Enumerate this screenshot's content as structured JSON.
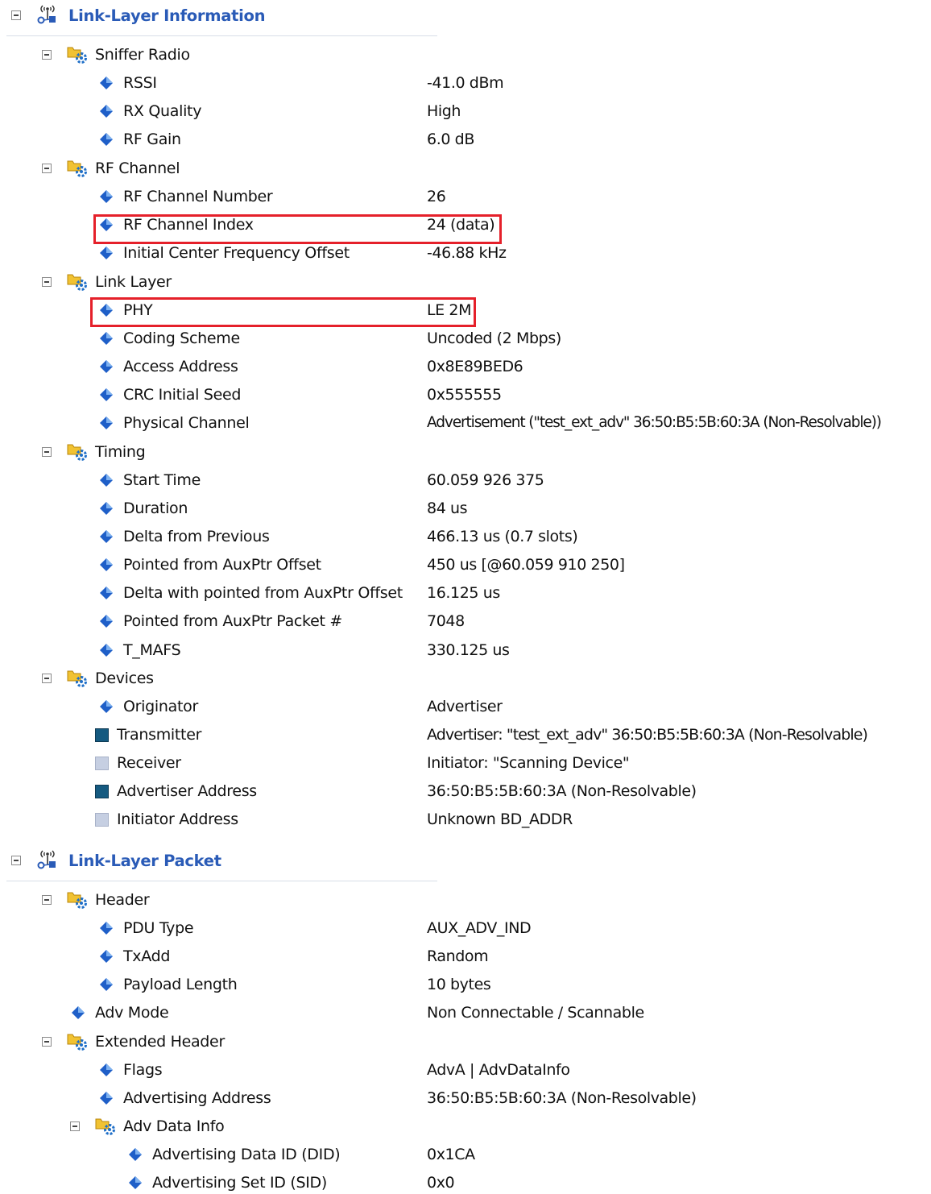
{
  "sections": [
    {
      "label": "Link-Layer Information"
    },
    {
      "label": "Link-Layer Packet"
    }
  ],
  "groups": {
    "sniffer_radio": "Sniffer Radio",
    "rf_channel": "RF Channel",
    "link_layer": "Link Layer",
    "timing": "Timing",
    "devices": "Devices",
    "header": "Header",
    "extended_header": "Extended Header",
    "adv_data_info": "Adv Data Info"
  },
  "fields": {
    "rssi": {
      "label": "RSSI",
      "value": "-41.0 dBm"
    },
    "rx_quality": {
      "label": "RX Quality",
      "value": "High"
    },
    "rf_gain": {
      "label": "RF Gain",
      "value": "6.0 dB"
    },
    "rf_channel_number": {
      "label": "RF Channel Number",
      "value": "26"
    },
    "rf_channel_index": {
      "label": "RF Channel Index",
      "value": "24 (data)"
    },
    "initial_center_freq_offset": {
      "label": "Initial Center Frequency Offset",
      "value": "-46.88 kHz"
    },
    "phy": {
      "label": "PHY",
      "value": "LE 2M"
    },
    "coding_scheme": {
      "label": "Coding Scheme",
      "value": "Uncoded (2 Mbps)"
    },
    "access_address": {
      "label": "Access Address",
      "value": "0x8E89BED6"
    },
    "crc_initial_seed": {
      "label": "CRC Initial Seed",
      "value": "0x555555"
    },
    "physical_channel": {
      "label": "Physical Channel",
      "value": "Advertisement (\"test_ext_adv\" 36:50:B5:5B:60:3A (Non-Resolvable))"
    },
    "start_time": {
      "label": "Start Time",
      "value": "60.059 926 375"
    },
    "duration": {
      "label": "Duration",
      "value": "84 us"
    },
    "delta_from_previous": {
      "label": "Delta from Previous",
      "value": "466.13 us (0.7 slots)"
    },
    "pointed_from_auxptr_offset": {
      "label": "Pointed from AuxPtr Offset",
      "value": "450 us [@60.059 910 250]"
    },
    "delta_with_pointed_from_auxptr_offset": {
      "label": "Delta with pointed from AuxPtr Offset",
      "value": "16.125 us"
    },
    "pointed_from_auxptr_packet": {
      "label": "Pointed from AuxPtr Packet #",
      "value": "7048"
    },
    "t_mafs": {
      "label": "T_MAFS",
      "value": "330.125 us"
    },
    "originator": {
      "label": "Originator",
      "value": "Advertiser"
    },
    "transmitter": {
      "label": "Transmitter",
      "value": "Advertiser: \"test_ext_adv\" 36:50:B5:5B:60:3A (Non-Resolvable)"
    },
    "receiver": {
      "label": "Receiver",
      "value": "Initiator: \"Scanning Device\""
    },
    "advertiser_address": {
      "label": "Advertiser Address",
      "value": "36:50:B5:5B:60:3A (Non-Resolvable)"
    },
    "initiator_address": {
      "label": "Initiator Address",
      "value": "Unknown BD_ADDR"
    },
    "pdu_type": {
      "label": "PDU Type",
      "value": "AUX_ADV_IND"
    },
    "txadd": {
      "label": "TxAdd",
      "value": "Random"
    },
    "payload_length": {
      "label": "Payload Length",
      "value": "10 bytes"
    },
    "adv_mode": {
      "label": "Adv Mode",
      "value": "Non Connectable / Scannable"
    },
    "flags": {
      "label": "Flags",
      "value": "AdvA | AdvDataInfo"
    },
    "advertising_address": {
      "label": "Advertising Address",
      "value": "36:50:B5:5B:60:3A (Non-Resolvable)"
    },
    "advertising_data_id": {
      "label": "Advertising Data ID (DID)",
      "value": "0x1CA"
    },
    "advertising_set_id": {
      "label": "Advertising Set ID (SID)",
      "value": "0x0"
    }
  },
  "colors": {
    "section_text": "#2a5bb7",
    "highlight_border": "#e5202a",
    "device_dark": "#155a80",
    "device_light": "#c6cfe2",
    "diamond": "#1f5fc8"
  },
  "icons": {
    "section": "network-antenna-icon",
    "group": "folder-gear-icon",
    "field": "blue-diamond-icon",
    "device_dark": "dark-square-icon",
    "device_light": "light-square-icon",
    "toggle": "collapse-toggle-icon"
  }
}
